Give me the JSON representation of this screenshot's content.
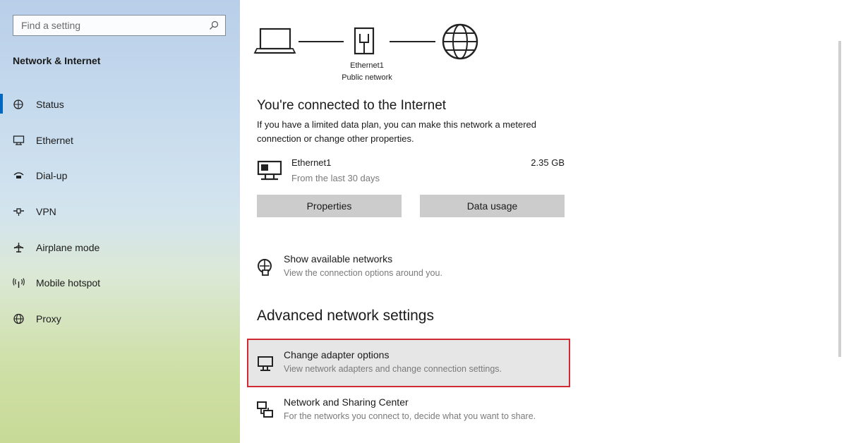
{
  "sidebar": {
    "search_placeholder": "Find a setting",
    "section_title": "Network & Internet",
    "items": [
      {
        "label": "Status",
        "icon": "status-icon",
        "active": true
      },
      {
        "label": "Ethernet",
        "icon": "ethernet-icon",
        "active": false
      },
      {
        "label": "Dial-up",
        "icon": "dialup-icon",
        "active": false
      },
      {
        "label": "VPN",
        "icon": "vpn-icon",
        "active": false
      },
      {
        "label": "Airplane mode",
        "icon": "airplane-icon",
        "active": false
      },
      {
        "label": "Mobile hotspot",
        "icon": "hotspot-icon",
        "active": false
      },
      {
        "label": "Proxy",
        "icon": "globe-icon",
        "active": false
      }
    ]
  },
  "status": {
    "diagram": {
      "adapter_name": "Ethernet1",
      "network_type": "Public network"
    },
    "heading": "You're connected to the Internet",
    "description": "If you have a limited data plan, you can make this network a metered connection or change other properties.",
    "connection": {
      "name": "Ethernet1",
      "subtitle": "From the last 30 days",
      "usage": "2.35 GB"
    },
    "buttons": {
      "properties": "Properties",
      "data_usage": "Data usage"
    },
    "show_networks": {
      "title": "Show available networks",
      "subtitle": "View the connection options around you."
    }
  },
  "advanced": {
    "heading": "Advanced network settings",
    "items": [
      {
        "title": "Change adapter options",
        "subtitle": "View network adapters and change connection settings.",
        "highlighted": true
      },
      {
        "title": "Network and Sharing Center",
        "subtitle": "For the networks you connect to, decide what you want to share.",
        "highlighted": false
      }
    ]
  },
  "colors": {
    "accent": "#0067c0",
    "highlight_border": "#d02b35",
    "button_bg": "#cccccc"
  }
}
